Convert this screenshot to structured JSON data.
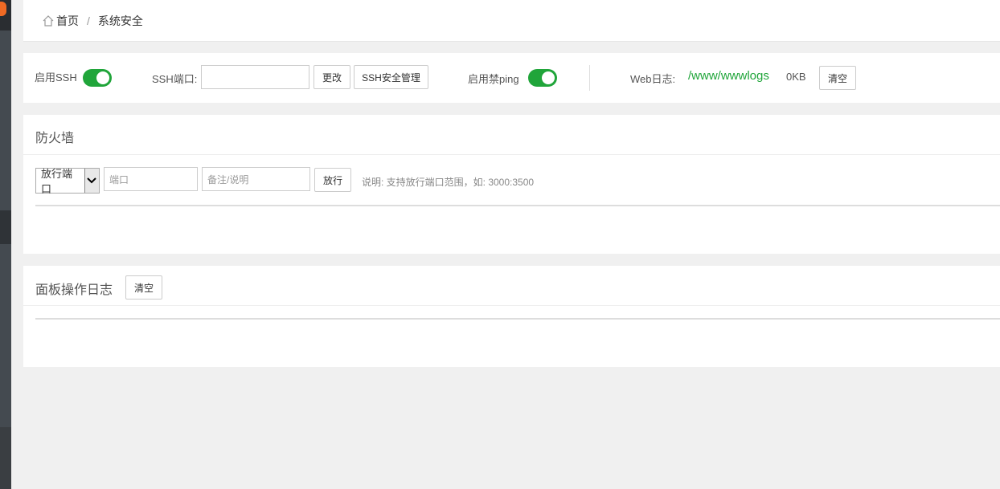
{
  "breadcrumb": {
    "home": "首页",
    "separator": "/",
    "current": "系统安全"
  },
  "ssh_bar": {
    "ssh_toggle_label": "启用SSH",
    "ssh_enabled": true,
    "ssh_port_label": "SSH端口:",
    "ssh_port_value": "",
    "change_button": "更改",
    "ssh_manage_button": "SSH安全管理",
    "ping_toggle_label": "启用禁ping",
    "ping_disabled": true,
    "web_log_label": "Web日志:",
    "web_log_path": "/www/wwwlogs",
    "web_log_size": "0KB",
    "clear_button": "清空"
  },
  "firewall": {
    "title": "防火墙",
    "type_select_value": "放行端口",
    "port_placeholder": "端口",
    "note_placeholder": "备注/说明",
    "allow_button": "放行",
    "hint": "说明: 支持放行端口范围，如: 3000:3500"
  },
  "panel_log": {
    "title": "面板操作日志",
    "clear_button": "清空"
  },
  "colors": {
    "accent": "#20a53a",
    "sidebar": "#3a3e42",
    "badge": "#f06a24"
  }
}
